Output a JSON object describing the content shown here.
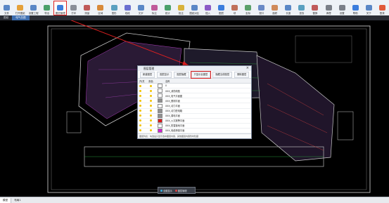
{
  "ribbon": {
    "items": [
      {
        "label": "文件",
        "icon": "file-icon",
        "color": "#5a87c6"
      },
      {
        "label": "打开图纸",
        "icon": "open-drawing-icon",
        "color": "#e5a13a"
      },
      {
        "label": "设置工程",
        "icon": "project-settings-icon",
        "color": "#5a87c6"
      },
      {
        "label": "导出",
        "icon": "export-icon",
        "color": "#4aa06a"
      },
      {
        "label": "图层管理",
        "icon": "layer-manage-icon",
        "color": "#3b7ddd",
        "selected": true
      },
      {
        "label": "打印",
        "icon": "print-icon",
        "color": "#8a8f99"
      },
      {
        "label": "测量",
        "icon": "measure-icon",
        "color": "#c05a5a"
      },
      {
        "label": "区域",
        "icon": "area-icon",
        "color": "#d88a3a"
      },
      {
        "label": "图形",
        "icon": "shape-icon",
        "color": "#5aa0c0"
      },
      {
        "label": "线段",
        "icon": "line-icon",
        "color": "#6a6fd0"
      },
      {
        "label": "文字",
        "icon": "text-icon",
        "color": "#5a87c6"
      },
      {
        "label": "标注",
        "icon": "annotation-icon",
        "color": "#c05a9a"
      },
      {
        "label": "统计",
        "icon": "statistics-icon",
        "color": "#4aa06a"
      },
      {
        "label": "批注",
        "icon": "note-icon",
        "color": "#d8b23a"
      },
      {
        "label": "图纸对比",
        "icon": "compare-icon",
        "color": "#5a87c6"
      },
      {
        "label": "插入",
        "icon": "insert-icon",
        "color": "#8a5ac6"
      },
      {
        "label": "图层",
        "icon": "layer-icon",
        "color": "#3b7ddd"
      },
      {
        "label": "块",
        "icon": "block-icon",
        "color": "#c0705a"
      },
      {
        "label": "坐标",
        "icon": "coordinate-icon",
        "color": "#5aa06a"
      },
      {
        "label": "视口",
        "icon": "viewport-icon",
        "color": "#6a8ac6"
      },
      {
        "label": "面积",
        "icon": "area-calc-icon",
        "color": "#d08a5a"
      },
      {
        "label": "长度",
        "icon": "length-icon",
        "color": "#5a87c6"
      },
      {
        "label": "查找",
        "icon": "find-icon",
        "color": "#5aa0c0"
      },
      {
        "label": "替换",
        "icon": "replace-icon",
        "color": "#c05a5a"
      },
      {
        "label": "清理",
        "icon": "clean-icon",
        "color": "#7a7f88"
      },
      {
        "label": "设置",
        "icon": "gear-icon",
        "color": "#7a7f88"
      },
      {
        "label": "帮助",
        "icon": "help-icon",
        "color": "#3b7ddd"
      },
      {
        "label": "关于",
        "icon": "about-icon",
        "color": "#5a87c6"
      },
      {
        "label": "登录",
        "icon": "login-icon",
        "color": "#e05a3a"
      }
    ]
  },
  "tabs": [
    {
      "label": "图纸",
      "active": false
    },
    {
      "label": "电气总图",
      "active": true
    }
  ],
  "layer_dialog": {
    "title": "图层管理",
    "tools": [
      {
        "label": "新建图层",
        "highlight": false
      },
      {
        "label": "图层显示",
        "highlight": false
      },
      {
        "label": "图层隐藏",
        "highlight": false
      },
      {
        "label": "只显示此图层",
        "highlight": true
      },
      {
        "label": "隐藏当前图层",
        "highlight": false
      },
      {
        "label": "删除图层",
        "highlight": false
      }
    ],
    "columns": [
      "开/关",
      "颜色",
      "名称"
    ],
    "rows": [
      {
        "color": "#ffffff",
        "name": "0"
      },
      {
        "color": "#ffffff",
        "name": "XXX_消防疏散"
      },
      {
        "color": "#ffffff",
        "name": "XXX_电气平面图"
      },
      {
        "color": "#909090",
        "name": "XXX_照明平面"
      },
      {
        "color": "#ffffff",
        "name": "XXX_动力平面"
      },
      {
        "color": "#909090",
        "name": "XXX_动力配电箱"
      },
      {
        "color": "#909090",
        "name": "XXX_弱电平面"
      },
      {
        "color": "#d81a1a",
        "name": "XXX_火灾报警平面"
      },
      {
        "color": "#ffffff",
        "name": "XXX_防雷接地平面"
      },
      {
        "color": "#d020d0",
        "name": "XXX_电缆桥架平面"
      }
    ],
    "footer": "图层列表：勾选后只显示选中图层内容，其他图层内容暂时隐藏"
  },
  "float_bar": [
    {
      "label": "全图显示",
      "color": "#38b0e0"
    },
    {
      "label": "图层管理",
      "color": "#e04040"
    }
  ],
  "status_tabs": [
    {
      "label": "模型",
      "active": true
    },
    {
      "label": "布局1",
      "active": false
    }
  ]
}
